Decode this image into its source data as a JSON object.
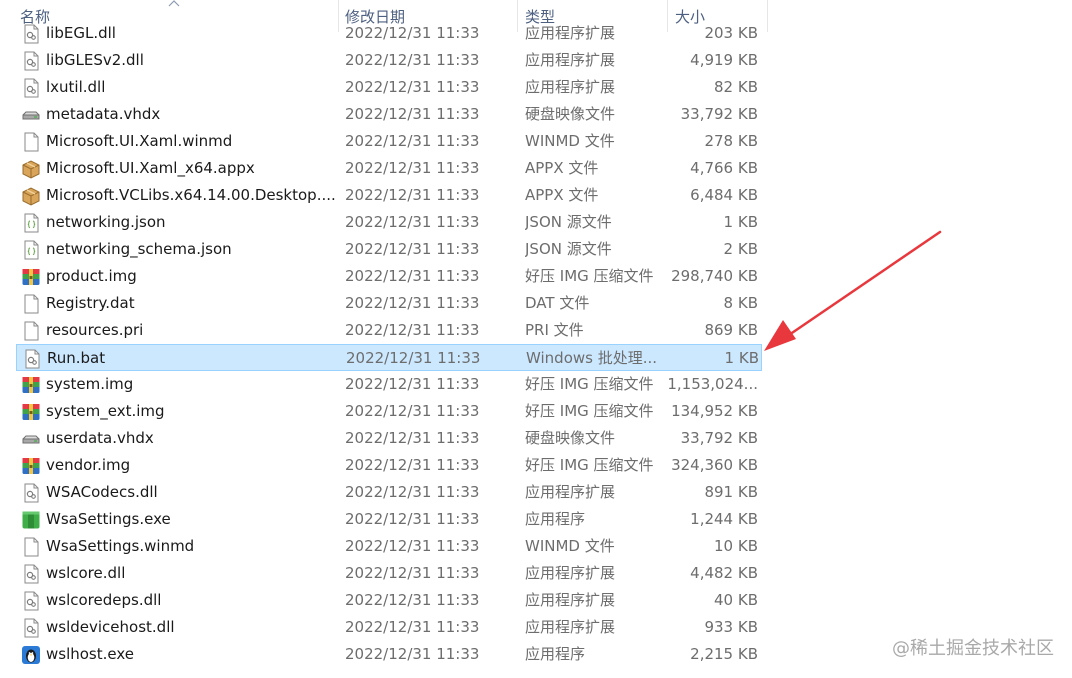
{
  "columns": {
    "name": "名称",
    "date": "修改日期",
    "type": "类型",
    "size": "大小"
  },
  "files": [
    {
      "name": "libEGL.dll",
      "date": "2022/12/31 11:33",
      "type": "应用程序扩展",
      "size": "203 KB",
      "icon": "dll"
    },
    {
      "name": "libGLESv2.dll",
      "date": "2022/12/31 11:33",
      "type": "应用程序扩展",
      "size": "4,919 KB",
      "icon": "dll"
    },
    {
      "name": "lxutil.dll",
      "date": "2022/12/31 11:33",
      "type": "应用程序扩展",
      "size": "82 KB",
      "icon": "dll"
    },
    {
      "name": "metadata.vhdx",
      "date": "2022/12/31 11:33",
      "type": "硬盘映像文件",
      "size": "33,792 KB",
      "icon": "disk"
    },
    {
      "name": "Microsoft.UI.Xaml.winmd",
      "date": "2022/12/31 11:33",
      "type": "WINMD 文件",
      "size": "278 KB",
      "icon": "blank"
    },
    {
      "name": "Microsoft.UI.Xaml_x64.appx",
      "date": "2022/12/31 11:33",
      "type": "APPX 文件",
      "size": "4,766 KB",
      "icon": "box"
    },
    {
      "name": "Microsoft.VCLibs.x64.14.00.Desktop....",
      "date": "2022/12/31 11:33",
      "type": "APPX 文件",
      "size": "6,484 KB",
      "icon": "box"
    },
    {
      "name": "networking.json",
      "date": "2022/12/31 11:33",
      "type": "JSON 源文件",
      "size": "1 KB",
      "icon": "json"
    },
    {
      "name": "networking_schema.json",
      "date": "2022/12/31 11:33",
      "type": "JSON 源文件",
      "size": "2 KB",
      "icon": "json"
    },
    {
      "name": "product.img",
      "date": "2022/12/31 11:33",
      "type": "好压 IMG 压缩文件",
      "size": "298,740 KB",
      "icon": "archive"
    },
    {
      "name": "Registry.dat",
      "date": "2022/12/31 11:33",
      "type": "DAT 文件",
      "size": "8 KB",
      "icon": "blank"
    },
    {
      "name": "resources.pri",
      "date": "2022/12/31 11:33",
      "type": "PRI 文件",
      "size": "869 KB",
      "icon": "blank"
    },
    {
      "name": "Run.bat",
      "date": "2022/12/31 11:33",
      "type": "Windows 批处理...",
      "size": "1 KB",
      "icon": "bat",
      "selected": true
    },
    {
      "name": "system.img",
      "date": "2022/12/31 11:33",
      "type": "好压 IMG 压缩文件",
      "size": "1,153,024...",
      "icon": "archive"
    },
    {
      "name": "system_ext.img",
      "date": "2022/12/31 11:33",
      "type": "好压 IMG 压缩文件",
      "size": "134,952 KB",
      "icon": "archive"
    },
    {
      "name": "userdata.vhdx",
      "date": "2022/12/31 11:33",
      "type": "硬盘映像文件",
      "size": "33,792 KB",
      "icon": "disk"
    },
    {
      "name": "vendor.img",
      "date": "2022/12/31 11:33",
      "type": "好压 IMG 压缩文件",
      "size": "324,360 KB",
      "icon": "archive"
    },
    {
      "name": "WSACodecs.dll",
      "date": "2022/12/31 11:33",
      "type": "应用程序扩展",
      "size": "891 KB",
      "icon": "dll"
    },
    {
      "name": "WsaSettings.exe",
      "date": "2022/12/31 11:33",
      "type": "应用程序",
      "size": "1,244 KB",
      "icon": "exe-green"
    },
    {
      "name": "WsaSettings.winmd",
      "date": "2022/12/31 11:33",
      "type": "WINMD 文件",
      "size": "10 KB",
      "icon": "blank"
    },
    {
      "name": "wslcore.dll",
      "date": "2022/12/31 11:33",
      "type": "应用程序扩展",
      "size": "4,482 KB",
      "icon": "dll"
    },
    {
      "name": "wslcoredeps.dll",
      "date": "2022/12/31 11:33",
      "type": "应用程序扩展",
      "size": "40 KB",
      "icon": "dll"
    },
    {
      "name": "wsldevicehost.dll",
      "date": "2022/12/31 11:33",
      "type": "应用程序扩展",
      "size": "933 KB",
      "icon": "dll"
    },
    {
      "name": "wslhost.exe",
      "date": "2022/12/31 11:33",
      "type": "应用程序",
      "size": "2,215 KB",
      "icon": "penguin"
    }
  ],
  "watermark": "@稀土掘金技术社区",
  "colors": {
    "selection_bg": "#cce8ff",
    "selection_border": "#99d1ff",
    "arrow": "#e8383d",
    "header_text": "#4d6082"
  }
}
